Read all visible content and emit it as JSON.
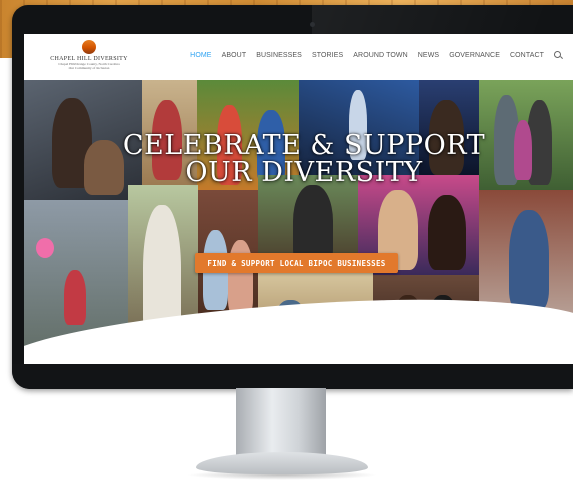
{
  "site": {
    "logo_title": "CHAPEL HILL DIVERSITY",
    "logo_subtitle_1": "Chapel Hill/Orange County, North Carolina",
    "logo_subtitle_2": "Our Community of Inclusion"
  },
  "nav": {
    "items": [
      {
        "label": "HOME",
        "active": true
      },
      {
        "label": "ABOUT",
        "active": false
      },
      {
        "label": "BUSINESSES",
        "active": false
      },
      {
        "label": "STORIES",
        "active": false
      },
      {
        "label": "AROUND TOWN",
        "active": false
      },
      {
        "label": "NEWS",
        "active": false
      },
      {
        "label": "GOVERNANCE",
        "active": false
      },
      {
        "label": "CONTACT",
        "active": false
      }
    ],
    "search_icon": "search-icon"
  },
  "hero": {
    "title_line_1": "CELEBRATE & SUPPORT",
    "title_line_2": "OUR DIVERSITY",
    "cta_label": "FIND & SUPPORT LOCAL BIPOC BUSINESSES"
  },
  "colors": {
    "accent_blue": "#2ea3f2",
    "cta_orange": "#e2792c",
    "bezel": "#111315"
  }
}
